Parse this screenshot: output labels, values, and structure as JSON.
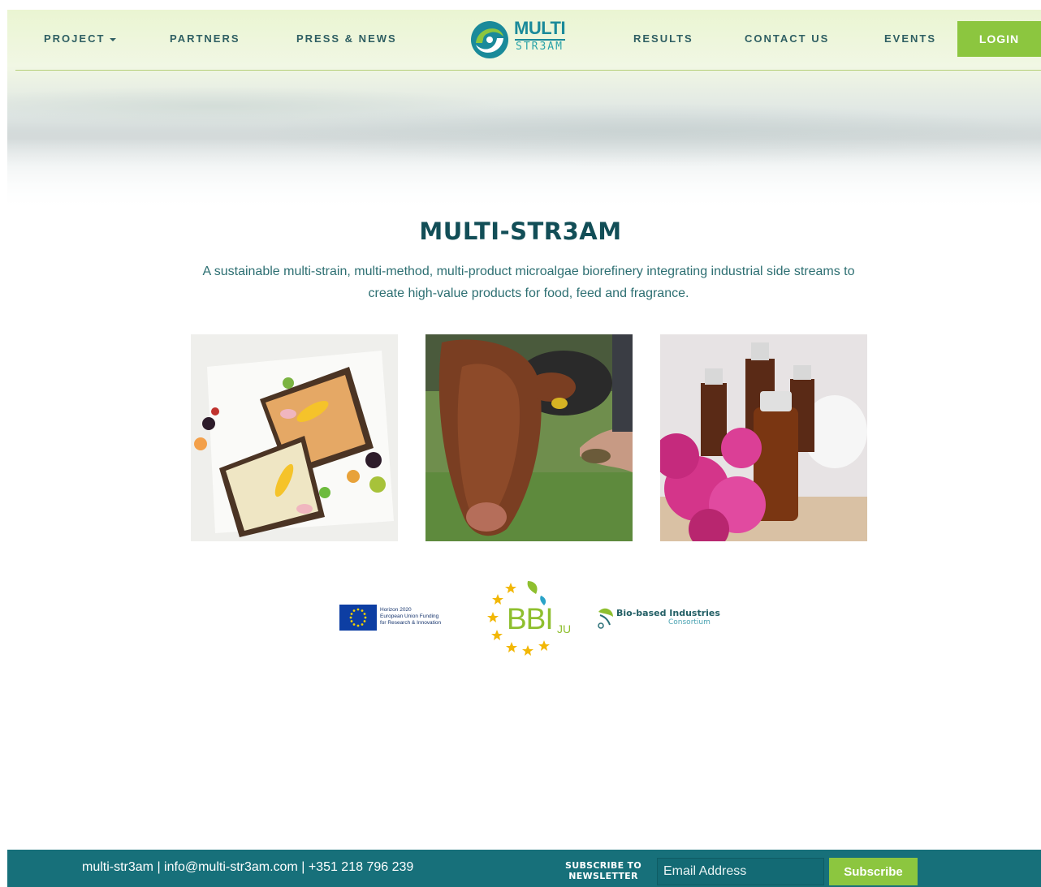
{
  "nav": {
    "left_items": [
      {
        "label": "PROJECT",
        "has_dropdown": true
      },
      {
        "label": "PARTNERS"
      },
      {
        "label": "PRESS & NEWS"
      }
    ],
    "right_items": [
      {
        "label": "RESULTS"
      },
      {
        "label": "CONTACT US"
      },
      {
        "label": "EVENTS"
      }
    ],
    "login_label": "LOGIN",
    "logo": {
      "top": "MULTI",
      "bottom": "STR3AM"
    }
  },
  "hero": {
    "title": "MULTI-STR3AM",
    "subtitle": "A sustainable multi-strain, multi-method, multi-product microalgae biorefinery integrating industrial side streams to create high-value products for food, feed and fragrance."
  },
  "images": [
    {
      "name": "food-image",
      "subject": "open sandwiches with spreads and fruit"
    },
    {
      "name": "feed-image",
      "subject": "cow eating feed from a hand"
    },
    {
      "name": "fragrance-image",
      "subject": "essential oil bottles with pink flowers"
    }
  ],
  "partner_logos": {
    "eu": {
      "text": "Horizon 2020\nEuropean Union Funding\nfor Research & Innovation"
    },
    "bbi": {
      "main": "BBI",
      "sub": "JU"
    },
    "bic": {
      "name": "Bio-based Industries",
      "sub": "Consortium"
    }
  },
  "footer": {
    "contact": "multi-str3am | info@multi-str3am.com | +351 218 796 239",
    "newsletter_label_line1": "SUBSCRIBE TO",
    "newsletter_label_line2": "NEWSLETTER",
    "email_placeholder": "Email Address",
    "subscribe_label": "Subscribe"
  },
  "colors": {
    "accent_green": "#8cc63f",
    "footer_teal": "#17707a",
    "title_teal": "#124e57",
    "text_teal": "#2d6f72"
  }
}
